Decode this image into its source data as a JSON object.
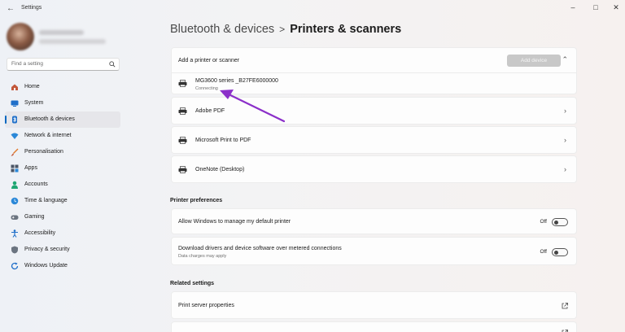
{
  "window": {
    "title": "Settings"
  },
  "sidebar": {
    "search_placeholder": "Find a setting",
    "items": [
      {
        "label": "Home",
        "icon": "home-icon",
        "color": "#c2573a"
      },
      {
        "label": "System",
        "icon": "monitor-icon",
        "color": "#1f6fc9"
      },
      {
        "label": "Bluetooth & devices",
        "icon": "bluetooth-icon",
        "color": "#1f6fc9",
        "selected": true
      },
      {
        "label": "Network & internet",
        "icon": "wifi-icon",
        "color": "#2b88d8"
      },
      {
        "label": "Personalisation",
        "icon": "brush-icon",
        "color": "#e07a2a"
      },
      {
        "label": "Apps",
        "icon": "apps-icon",
        "color": "#4a5565"
      },
      {
        "label": "Accounts",
        "icon": "person-icon",
        "color": "#1ea672"
      },
      {
        "label": "Time & language",
        "icon": "globe-clock-icon",
        "color": "#2b88d8"
      },
      {
        "label": "Gaming",
        "icon": "gamepad-icon",
        "color": "#6b7480"
      },
      {
        "label": "Accessibility",
        "icon": "accessibility-icon",
        "color": "#1f6fc9"
      },
      {
        "label": "Privacy & security",
        "icon": "shield-icon",
        "color": "#6b7480"
      },
      {
        "label": "Windows Update",
        "icon": "update-icon",
        "color": "#1f6fc9"
      }
    ]
  },
  "breadcrumb": {
    "parent": "Bluetooth & devices",
    "separator": ">",
    "current": "Printers & scanners"
  },
  "add_printer": {
    "label": "Add a printer or scanner",
    "button_label": "Add device"
  },
  "printers": [
    {
      "name": "MG3600 series _B27FE6000000",
      "status": "Connecting"
    },
    {
      "name": "Adobe PDF"
    },
    {
      "name": "Microsoft Print to PDF"
    },
    {
      "name": "OneNote (Desktop)"
    }
  ],
  "printer_preferences": {
    "title": "Printer preferences",
    "items": [
      {
        "label": "Allow Windows to manage my default printer",
        "state": "Off"
      },
      {
        "label": "Download drivers and device software over metered connections",
        "sublabel": "Data charges may apply",
        "state": "Off"
      }
    ]
  },
  "related_settings": {
    "title": "Related settings",
    "items": [
      {
        "label": "Print server properties"
      }
    ]
  },
  "colors": {
    "accent": "#0067c0",
    "annotation_arrow": "#8b2fc9"
  }
}
